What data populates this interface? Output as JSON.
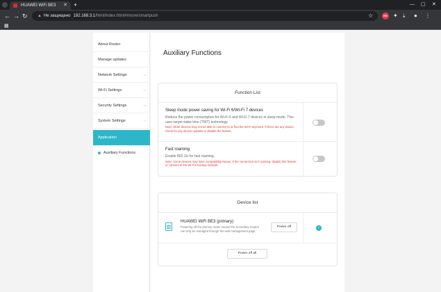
{
  "browser": {
    "tab_title": "HUAWEI WiFi BE3",
    "tab_close": "✕",
    "new_tab": "+",
    "security_text": "Не защищено",
    "url_host": "192.168.3.1",
    "url_path": "/html/index.html#/more/smartpush",
    "icons": [
      "back-icon",
      "forward-icon",
      "reload-icon",
      "lock-warning-icon",
      "star-icon",
      "extension-icon",
      "download-icon",
      "profile-icon",
      "menu-icon",
      "apps-icon"
    ]
  },
  "sidebar": {
    "items": [
      {
        "label": "About Router"
      },
      {
        "label": "Manage updates"
      },
      {
        "label": "Network Settings"
      },
      {
        "label": "Wi-Fi Settings"
      },
      {
        "label": "Security Settings"
      },
      {
        "label": "System Settings"
      },
      {
        "label": "Application"
      }
    ],
    "sub_item": "Auxiliary Functions"
  },
  "main": {
    "title": "Auxiliary Functions",
    "function_list": {
      "heading": "Function List",
      "items": [
        {
          "title": "Sleep mode power saving for Wi-Fi 6/Wi-Fi 7 devices",
          "description": "Reduce the power consumption for Wi-Fi 6 and Wi-Fi 7 devices in sleep mode. This uses target wake time (TWT) technology.",
          "note": "Note: Older devices may not be able to connect to or find the Wi-Fi anymore. If there are any issues, check for any device updates or disable the feature.",
          "enabled": false
        },
        {
          "title": "Fast roaming",
          "description": "Enable 802.11r for fast roaming.",
          "note": "Note: Some devices may have compatibility issues. If the connection isn't working, disable this feature or connect to the Wi-Fi's backup network.",
          "enabled": false
        }
      ]
    },
    "device_list": {
      "heading": "Device list",
      "devices": [
        {
          "name": "HUAWEI WiFi BE3 (primary)",
          "description": "Powering off the primary router means the secondary routers can only be managed through the web management page.",
          "button": "Power off",
          "selected": true
        }
      ],
      "power_off_all": "Power off all"
    }
  },
  "colors": {
    "accent": "#2cb7c9",
    "warning": "#e53935"
  }
}
